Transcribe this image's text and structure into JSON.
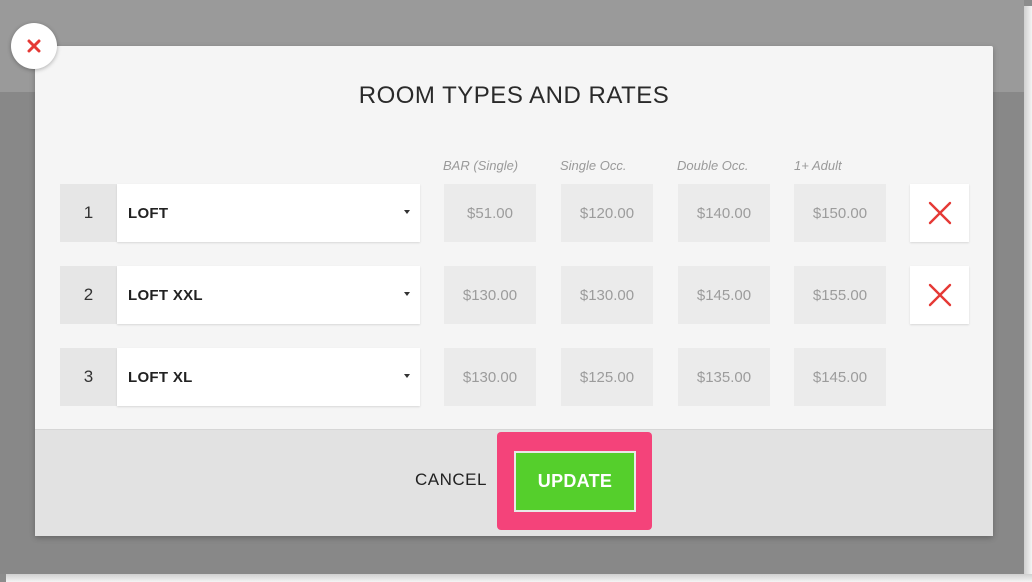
{
  "modal": {
    "title": "ROOM TYPES AND RATES",
    "close_icon": "close-x-icon",
    "accent_color": "#e53935"
  },
  "columns": [
    "BAR (Single)",
    "Single Occ.",
    "Double Occ.",
    "1+ Adult"
  ],
  "rows": [
    {
      "number": "1",
      "room_type": "LOFT",
      "rates": [
        "$51.00",
        "$120.00",
        "$140.00",
        "$150.00"
      ],
      "deletable": true
    },
    {
      "number": "2",
      "room_type": "LOFT XXL",
      "rates": [
        "$130.00",
        "$130.00",
        "$145.00",
        "$155.00"
      ],
      "deletable": true
    },
    {
      "number": "3",
      "room_type": "LOFT XL",
      "rates": [
        "$130.00",
        "$125.00",
        "$135.00",
        "$145.00"
      ],
      "deletable": false
    }
  ],
  "footer": {
    "cancel_label": "CANCEL",
    "update_label": "UPDATE",
    "update_color": "#55cf2c",
    "highlight_color": "#f4437a"
  }
}
